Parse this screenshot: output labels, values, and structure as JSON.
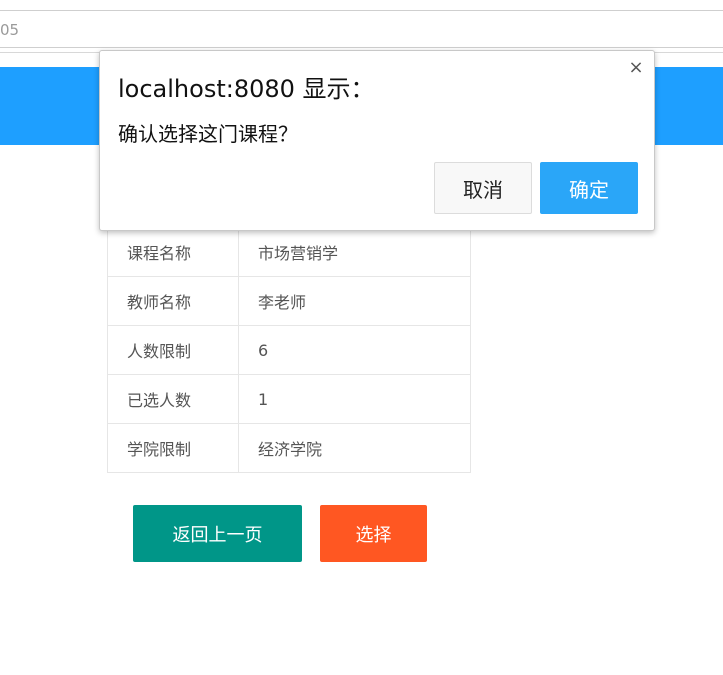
{
  "browser": {
    "address_fragment": "05"
  },
  "dialog": {
    "title": "localhost:8080 显示：",
    "close": "×",
    "message": "确认选择这门课程？",
    "cancel_label": "取消",
    "ok_label": "确定"
  },
  "course_info": {
    "rows": [
      {
        "label": "课程名称",
        "value": "市场营销学"
      },
      {
        "label": "教师名称",
        "value": "李老师"
      },
      {
        "label": "人数限制",
        "value": "6"
      },
      {
        "label": "已选人数",
        "value": "1"
      },
      {
        "label": "学院限制",
        "value": "经济学院"
      }
    ]
  },
  "actions": {
    "back_label": "返回上一页",
    "select_label": "选择"
  },
  "colors": {
    "header_blue": "#1E9FFF",
    "back_button": "#009688",
    "select_button": "#FF5722",
    "dialog_ok": "#2AA6F8"
  }
}
